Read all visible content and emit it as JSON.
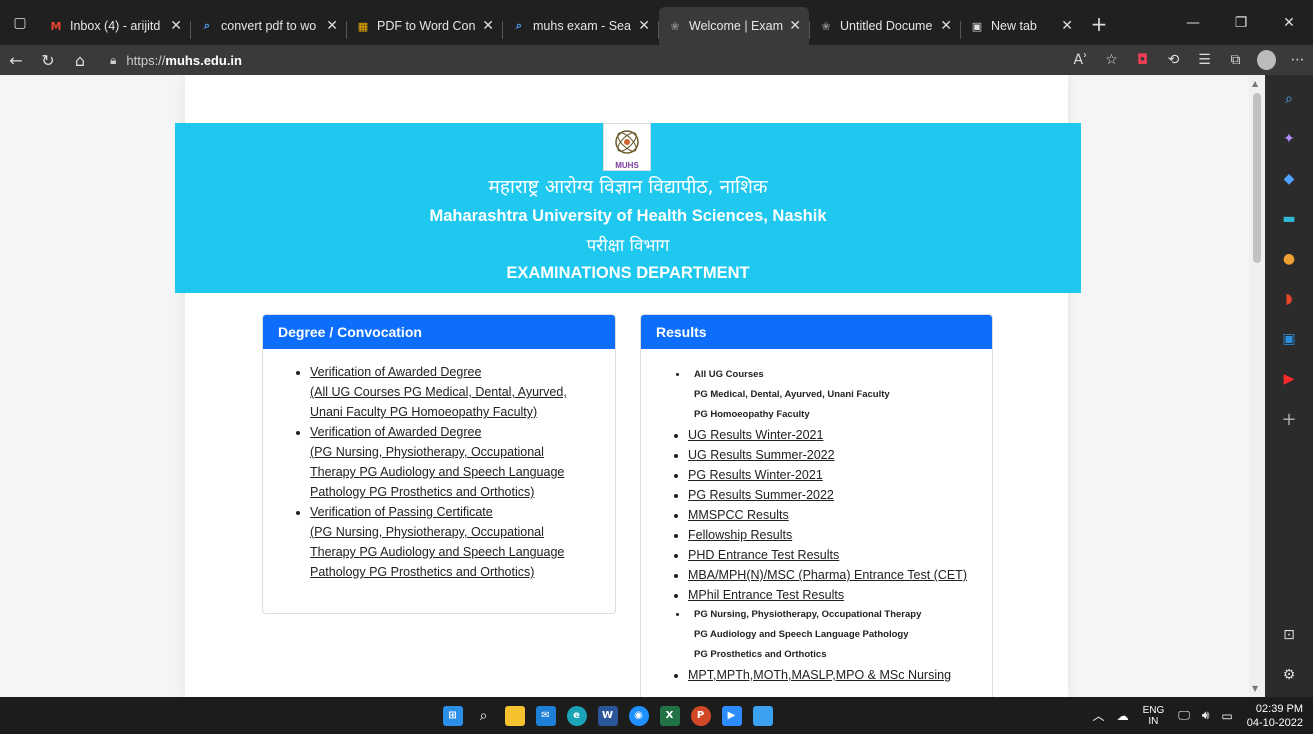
{
  "browser": {
    "tabs": [
      {
        "title": "Inbox (4) - arijitd",
        "icon": "gmail-icon",
        "color": "#ea4335",
        "glyph": "M",
        "active": false
      },
      {
        "title": "convert pdf to wo",
        "icon": "search-icon",
        "color": "#4ea1ff",
        "glyph": "⌕",
        "active": false
      },
      {
        "title": "PDF to Word Con",
        "icon": "pdf-app-icon",
        "color": "#f4b400",
        "glyph": "▦",
        "active": false
      },
      {
        "title": "muhs exam - Sea",
        "icon": "search-icon",
        "color": "#4ea1ff",
        "glyph": "⌕",
        "active": false
      },
      {
        "title": "Welcome | Exam",
        "icon": "muhs-favicon-icon",
        "color": "#888888",
        "glyph": "❀",
        "active": true
      },
      {
        "title": "Untitled Docume",
        "icon": "muhs-favicon-icon",
        "color": "#888888",
        "glyph": "❀",
        "active": false
      },
      {
        "title": "New tab",
        "icon": "newtab-icon",
        "color": "#dddddd",
        "glyph": "▣",
        "active": false
      }
    ],
    "url_prefix": "https://",
    "url_host": "muhs.edu.in"
  },
  "page": {
    "banner": {
      "marathi_name": "महाराष्ट्र आरोग्य विज्ञान विद्यापीठ, नाशिक",
      "english_name": "Maharashtra University of Health Sciences, Nashik",
      "marathi_dept": "परीक्षा विभाग",
      "english_dept": "EXAMINATIONS DEPARTMENT",
      "logo_text": "MUHS",
      "color": "#1ec8ef"
    },
    "degree_card": {
      "title": "Degree / Convocation",
      "items": [
        {
          "label": "Verification of Awarded Degree",
          "sub": [
            "(All UG Courses PG Medical, Dental, Ayurved,",
            "Unani Faculty PG Homoeopathy Faculty)"
          ]
        },
        {
          "label": "Verification of Awarded Degree",
          "sub": [
            "(PG Nursing, Physiotherapy, Occupational",
            "Therapy PG Audiology and Speech Language",
            "Pathology PG Prosthetics and Orthotics)"
          ]
        },
        {
          "label": "Verification of Passing Certificate",
          "sub": [
            "(PG Nursing, Physiotherapy, Occupational",
            "Therapy PG Audiology and Speech Language",
            "Pathology PG Prosthetics and Orthotics)"
          ]
        }
      ]
    },
    "results_card": {
      "title": "Results",
      "group1": [
        "All UG Courses",
        "PG Medical, Dental, Ayurved, Unani Faculty",
        "PG Homoeopathy Faculty"
      ],
      "links": [
        "UG Results Winter-2021",
        "UG Results Summer-2022",
        "PG Results Winter-2021",
        "PG Results Summer-2022",
        "MMSPCC Results",
        "Fellowship Results",
        "PHD Entrance Test Results",
        "MBA/MPH(N)/MSC (Pharma) Entrance Test (CET)",
        "MPhil Entrance Test Results"
      ],
      "group2": [
        "PG Nursing, Physiotherapy, Occupational Therapy",
        "PG Audiology and Speech Language Pathology",
        "PG Prosthetics and Orthotics"
      ],
      "last_link": "MPT,MPTh,MOTh,MASLP,MPO & MSc Nursing"
    },
    "header_color": "#0d6efd"
  },
  "taskbar": {
    "lang_top": "ENG",
    "lang_bottom": "IN",
    "time": "02:39 PM",
    "date": "04-10-2022"
  }
}
